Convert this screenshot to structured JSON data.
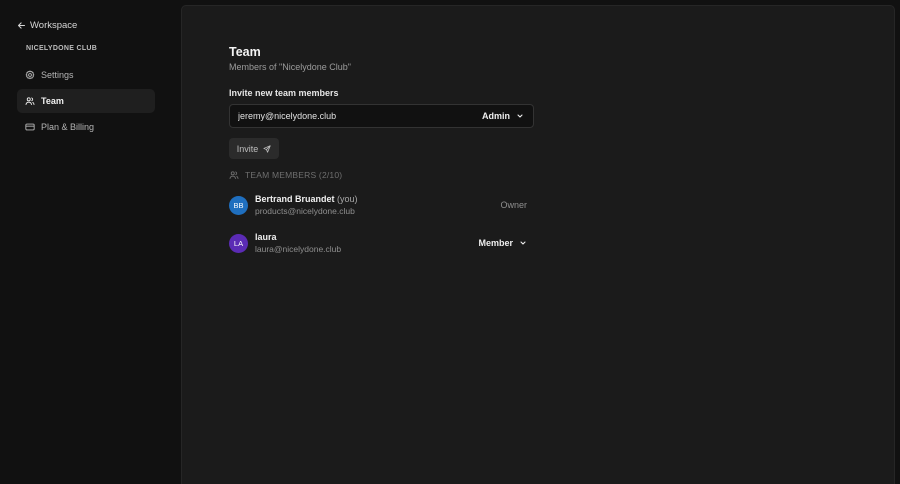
{
  "sidebar": {
    "back_label": "Workspace",
    "org_label": "NICELYDONE CLUB",
    "items": [
      {
        "label": "Settings",
        "icon": "gear-icon"
      },
      {
        "label": "Team",
        "icon": "users-icon",
        "active": true
      },
      {
        "label": "Plan & Billing",
        "icon": "credit-card-icon"
      }
    ]
  },
  "main": {
    "title": "Team",
    "subtitle": "Members of \"Nicelydone Club\"",
    "invite": {
      "section_label": "Invite new team members",
      "email_value": "jeremy@nicelydone.club",
      "role_value": "Admin",
      "button_label": "Invite"
    },
    "members_header": "TEAM MEMBERS (2/10)",
    "members": [
      {
        "initials": "BB",
        "name": "Bertrand Bruandet",
        "you": "(you)",
        "email": "products@nicelydone.club",
        "role": "Owner",
        "avatar_color": "#1f6fbf"
      },
      {
        "initials": "LA",
        "name": "laura",
        "email": "laura@nicelydone.club",
        "role": "Member",
        "avatar_color": "#5b2bb5"
      }
    ]
  },
  "colors": {
    "background": "#111111",
    "panel": "#1b1b1b",
    "active_nav": "#1f1f1f"
  }
}
